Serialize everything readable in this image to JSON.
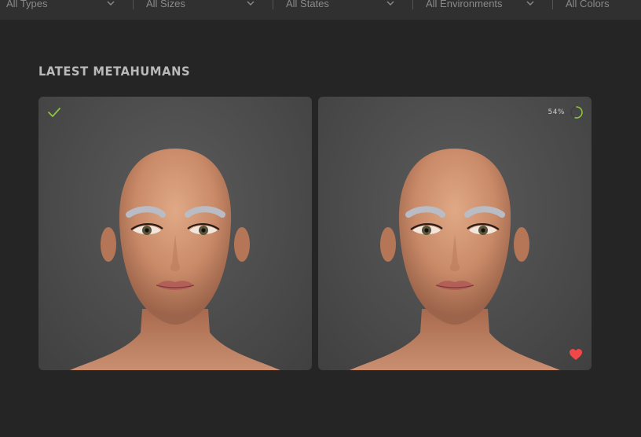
{
  "filters": [
    {
      "label": "All Types"
    },
    {
      "label": "All Sizes"
    },
    {
      "label": "All States"
    },
    {
      "label": "All Environments"
    },
    {
      "label": "All Colors"
    }
  ],
  "section": {
    "title": "LATEST METAHUMANS"
  },
  "cards": [
    {
      "status_icon": "check-icon",
      "status_color": "#8cc63f",
      "favorite": false
    },
    {
      "status_icon": "progress-ring-icon",
      "progress_text": "54%",
      "progress": 0.54,
      "status_color": "#8cc63f",
      "favorite": true,
      "favorite_color": "#f04848"
    }
  ],
  "colors": {
    "background": "#252525",
    "card": "#4e4e4e",
    "accent": "#8cc63f",
    "heart": "#f04848"
  }
}
